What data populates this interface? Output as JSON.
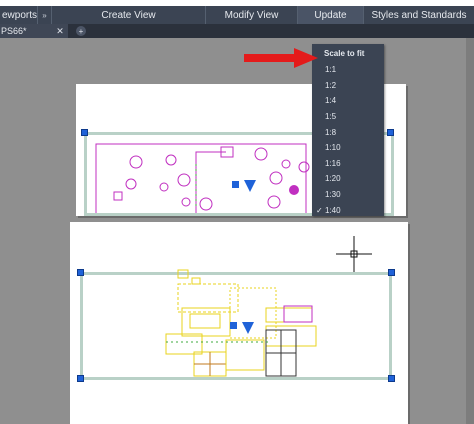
{
  "ribbon": {
    "panels": [
      {
        "label": "ewports"
      },
      {
        "label": "Create View"
      },
      {
        "label": "Modify View"
      },
      {
        "label": "Update"
      },
      {
        "label": "Styles and Standards"
      }
    ],
    "pin_glyph": "»"
  },
  "tabs": {
    "active_tab": "PS66*",
    "close_glyph": "✕",
    "add_glyph": "+"
  },
  "scale_menu": {
    "header": "Scale to fit",
    "items": [
      "1:1",
      "1:2",
      "1:4",
      "1:5",
      "1:8",
      "1:10",
      "1:16",
      "1:20",
      "1:30",
      "1:40"
    ],
    "checked_item": "1:40",
    "check_glyph": "✓"
  },
  "colors": {
    "ribbon_bg": "#3b4453",
    "tabbar_bg": "#2b313c",
    "canvas_bg": "#8f8f8f",
    "menu_bg": "#3b4453",
    "annotation_arrow": "#e41b1b",
    "viewport_border": "#b9d1c7",
    "grip_blue": "#1f62d8",
    "drawing_magenta": "#c02fc0",
    "drawing_yellow": "#e8d31c",
    "drawing_green": "#3ea83e"
  },
  "icons": {
    "annotation": "red-arrow-icon",
    "cursor": "crosshair-cursor-icon",
    "tab_close": "close-icon",
    "tab_add": "plus-icon",
    "ribbon_pin": "double-chevron-icon"
  }
}
